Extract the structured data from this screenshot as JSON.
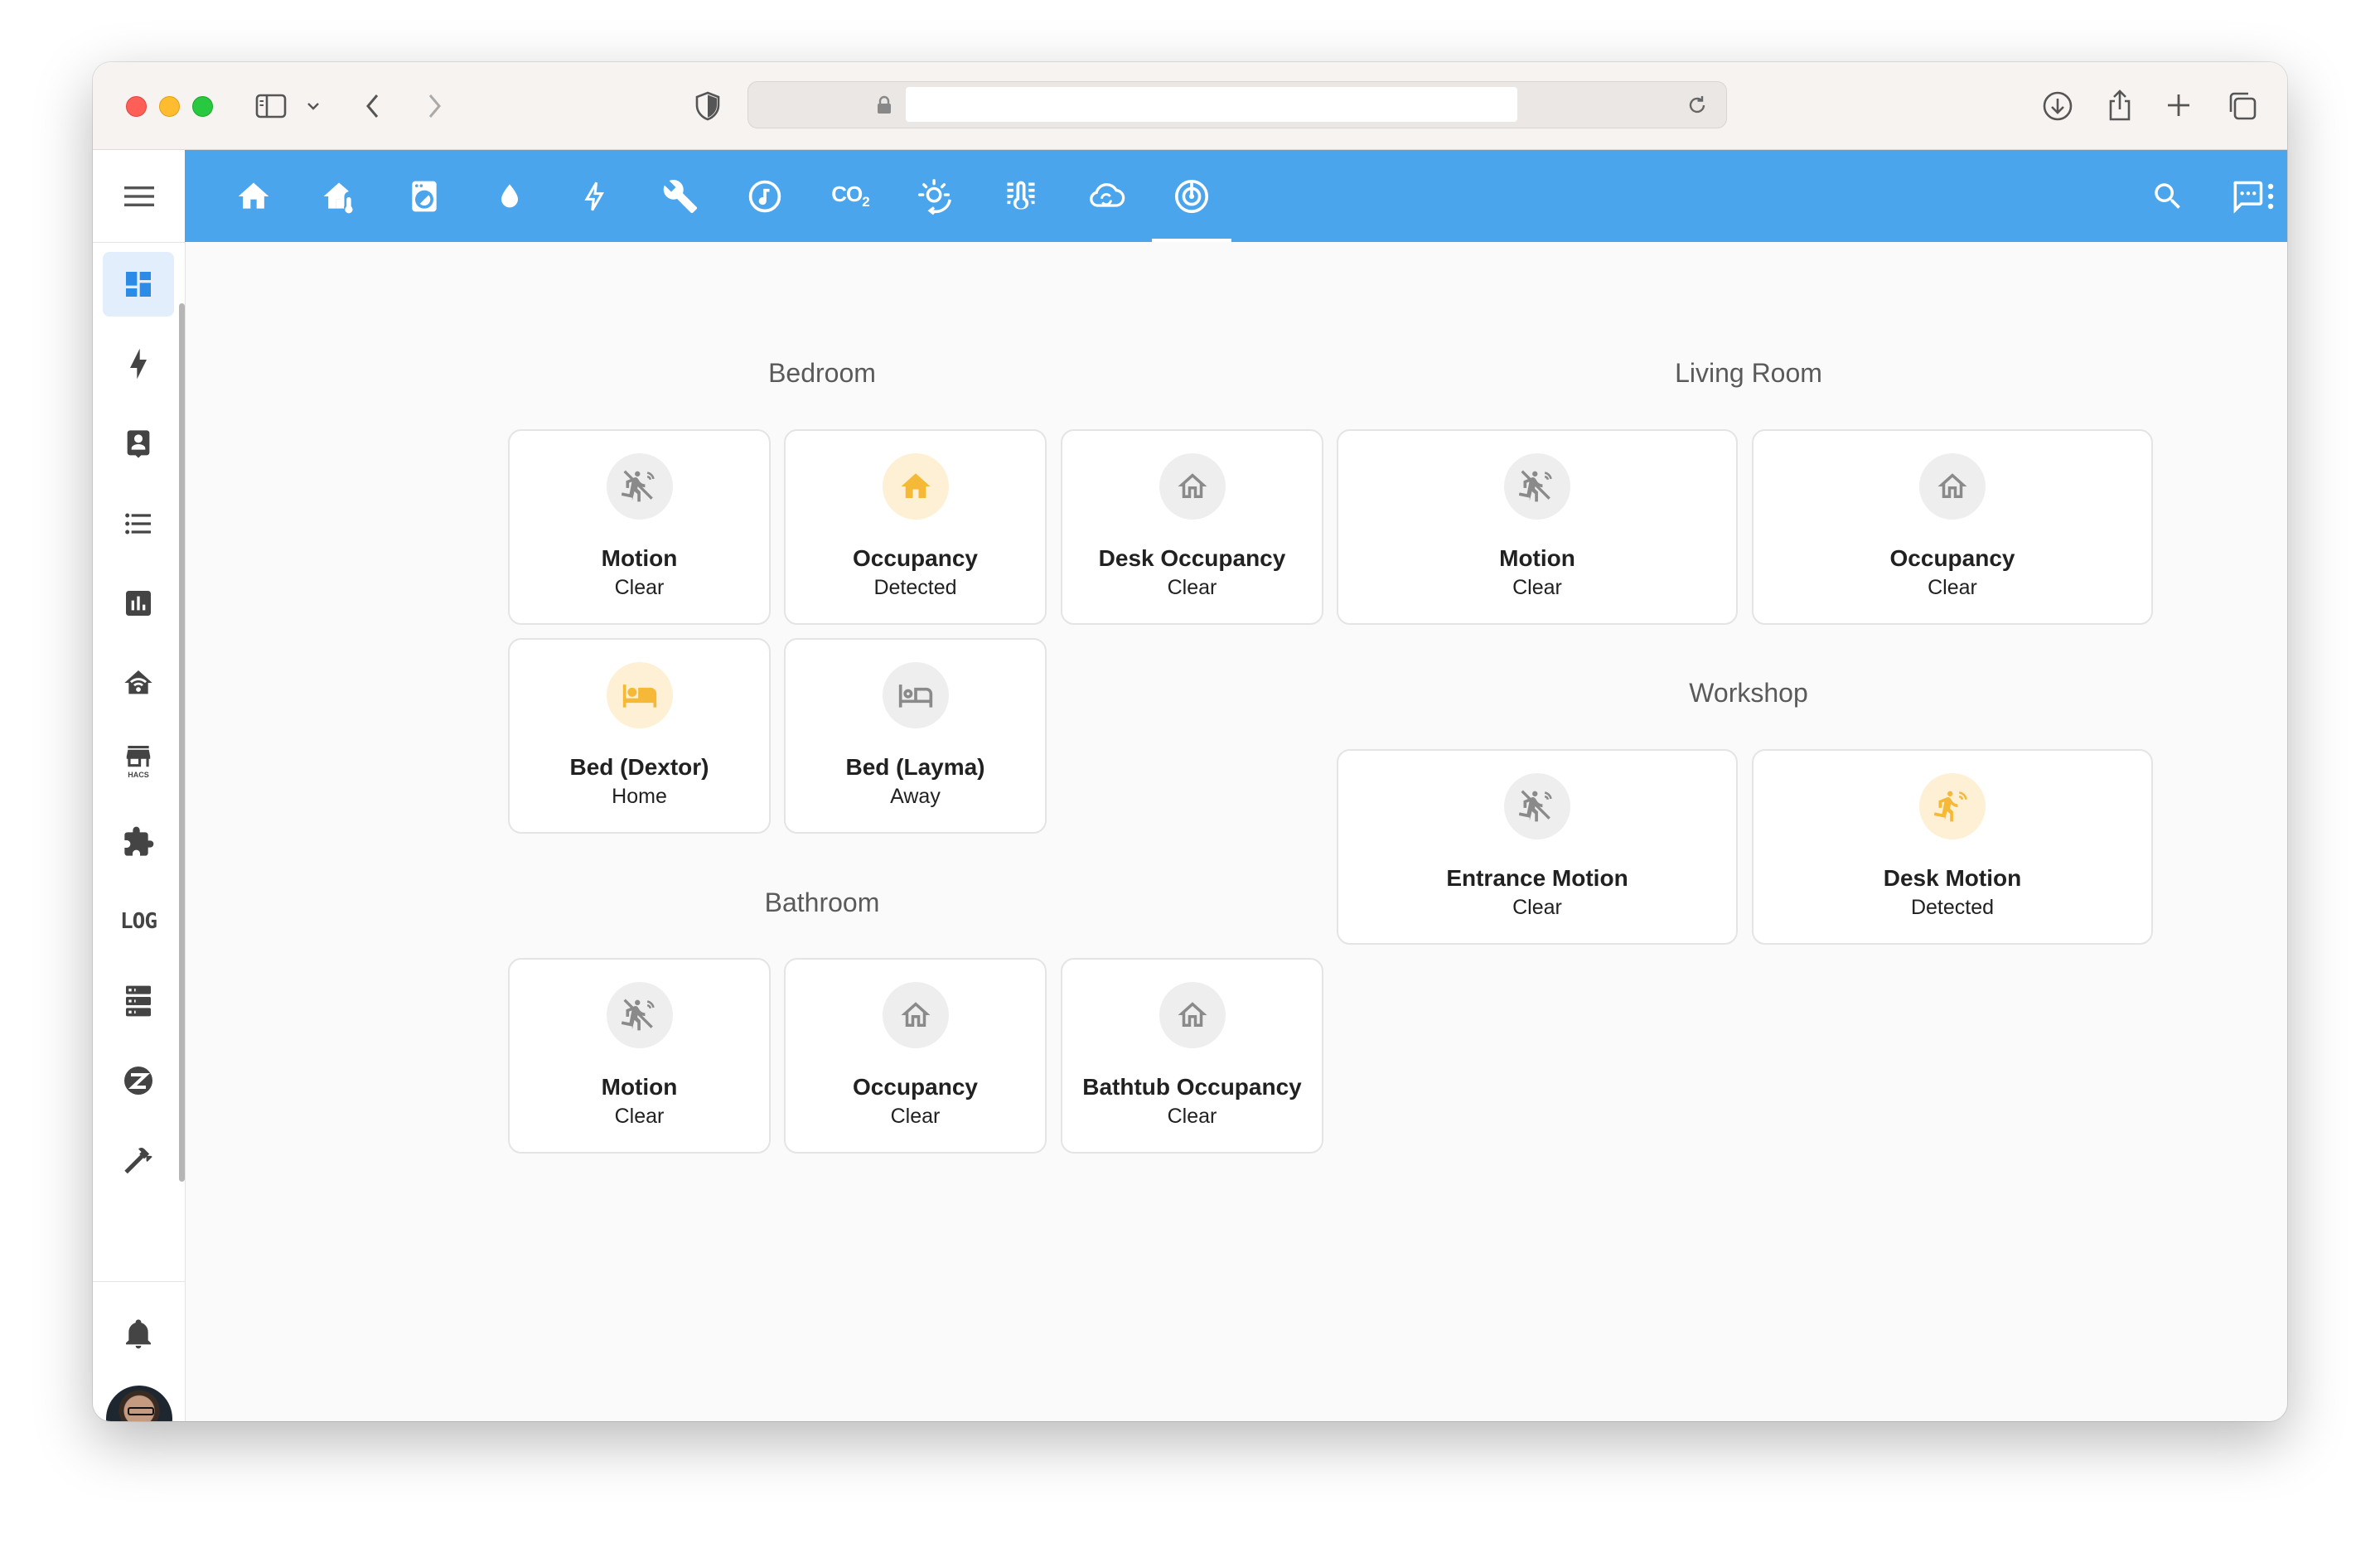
{
  "browser": {
    "url_text": ""
  },
  "sidebar": {
    "menu_icon": "menu-icon",
    "items": [
      {
        "icon": "dashboard-icon",
        "active": true
      },
      {
        "icon": "energy-icon"
      },
      {
        "icon": "map-person-icon"
      },
      {
        "icon": "logbook-list-icon"
      },
      {
        "icon": "history-chart-icon"
      },
      {
        "icon": "home-wifi-icon"
      },
      {
        "icon": "hacs-store-icon",
        "label": "HACS"
      },
      {
        "icon": "puzzle-icon"
      },
      {
        "icon": "log-icon",
        "label": "LOG"
      },
      {
        "icon": "server-icon"
      },
      {
        "icon": "zwave-icon"
      },
      {
        "icon": "hammer-icon"
      }
    ],
    "notifications_icon": "bell-icon",
    "avatar": "user-avatar"
  },
  "topbar": {
    "tabs": [
      {
        "icon": "home-icon"
      },
      {
        "icon": "home-thermometer-icon"
      },
      {
        "icon": "washing-machine-icon"
      },
      {
        "icon": "water-drop-icon"
      },
      {
        "icon": "lightning-icon"
      },
      {
        "icon": "wrench-icon"
      },
      {
        "icon": "music-icon"
      },
      {
        "icon": "co2-icon",
        "label": "CO",
        "sub": "2"
      },
      {
        "icon": "sun-cycle-icon"
      },
      {
        "icon": "thermometer-lines-icon"
      },
      {
        "icon": "cloud-sync-icon"
      },
      {
        "icon": "radar-icon",
        "active": true
      }
    ],
    "actions": [
      "search-icon",
      "assist-chat-icon",
      "more-vertical-icon"
    ]
  },
  "sections": {
    "bedroom": {
      "title": "Bedroom",
      "cards": [
        {
          "name": "Motion",
          "state": "Clear",
          "icon": "motion-sensor-off-icon",
          "active": false
        },
        {
          "name": "Occupancy",
          "state": "Detected",
          "icon": "home-icon",
          "active": true
        },
        {
          "name": "Desk Occupancy",
          "state": "Clear",
          "icon": "home-outline-icon",
          "active": false
        },
        {
          "name": "Bed (Dextor)",
          "state": "Home",
          "icon": "bed-icon",
          "active": true
        },
        {
          "name": "Bed (Layma)",
          "state": "Away",
          "icon": "bed-outline-icon",
          "active": false
        }
      ]
    },
    "bathroom": {
      "title": "Bathroom",
      "cards": [
        {
          "name": "Motion",
          "state": "Clear",
          "icon": "motion-sensor-off-icon",
          "active": false
        },
        {
          "name": "Occupancy",
          "state": "Clear",
          "icon": "home-outline-icon",
          "active": false
        },
        {
          "name": "Bathtub Occupancy",
          "state": "Clear",
          "icon": "home-outline-icon",
          "active": false
        }
      ]
    },
    "living_room": {
      "title": "Living Room",
      "cards": [
        {
          "name": "Motion",
          "state": "Clear",
          "icon": "motion-sensor-off-icon",
          "active": false
        },
        {
          "name": "Occupancy",
          "state": "Clear",
          "icon": "home-outline-icon",
          "active": false
        }
      ]
    },
    "workshop": {
      "title": "Workshop",
      "cards": [
        {
          "name": "Entrance Motion",
          "state": "Clear",
          "icon": "motion-sensor-off-icon",
          "active": false
        },
        {
          "name": "Desk Motion",
          "state": "Detected",
          "icon": "motion-sensor-icon",
          "active": true
        }
      ]
    }
  },
  "colors": {
    "header": "#4ba5ec",
    "active_icon": "#f5b937",
    "active_icon_bg": "#fdf0d5",
    "inactive_icon": "#8a8a8a",
    "inactive_icon_bg": "#eeeeee"
  }
}
